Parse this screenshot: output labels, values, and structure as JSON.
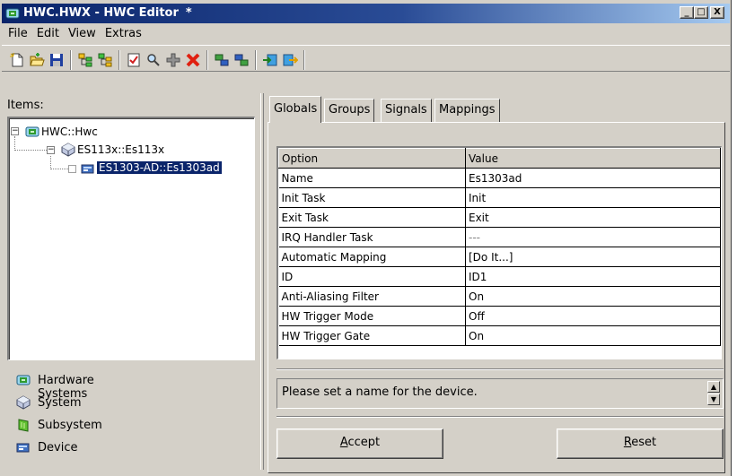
{
  "window": {
    "title": "HWC.HWX - HWC Editor",
    "modified_marker": "*",
    "controls": {
      "minimize": "_",
      "maximize": "□",
      "close": "X"
    }
  },
  "menu": [
    {
      "label": "File"
    },
    {
      "label": "Edit"
    },
    {
      "label": "View"
    },
    {
      "label": "Extras"
    }
  ],
  "toolbar": {
    "icons": [
      "new-file-icon",
      "open-folder-icon",
      "save-disk-icon",
      "tree-structure-icon",
      "tree-structure-alt-icon",
      "checklist-icon",
      "find-icon",
      "add-plus-icon",
      "delete-x-icon",
      "connect-icon",
      "connect-alt-icon",
      "import-icon",
      "export-icon"
    ]
  },
  "left_panel": {
    "items_label": "Items:",
    "tree": [
      {
        "label": "HWC::Hwc",
        "expander": "−",
        "icon": "hardware-system-icon"
      },
      {
        "label": "ES113x::Es113x",
        "expander": "−",
        "icon": "system-icon"
      },
      {
        "label": "ES1303-AD::Es1303ad",
        "expander": "",
        "icon": "device-icon",
        "selected": true
      }
    ],
    "legend": [
      {
        "label": "Hardware Systems",
        "icon": "hardware-system-icon"
      },
      {
        "label": "System",
        "icon": "system-icon"
      },
      {
        "label": "Subsystem",
        "icon": "subsystem-icon"
      },
      {
        "label": "Device",
        "icon": "device-icon"
      }
    ]
  },
  "tabs": [
    {
      "label": "Globals",
      "active": true
    },
    {
      "label": "Groups"
    },
    {
      "label": "Signals"
    },
    {
      "label": "Mappings"
    }
  ],
  "grid": {
    "headers": {
      "option": "Option",
      "value": "Value"
    },
    "rows": [
      {
        "option": "Name",
        "value": "Es1303ad"
      },
      {
        "option": "Init Task",
        "value": "Init"
      },
      {
        "option": "Exit Task",
        "value": "Exit"
      },
      {
        "option": "IRQ Handler Task",
        "value": "---"
      },
      {
        "option": "Automatic Mapping",
        "value": "[Do It...]"
      },
      {
        "option": "ID",
        "value": "ID1"
      },
      {
        "option": "Anti-Aliasing Filter",
        "value": "On"
      },
      {
        "option": "HW Trigger Mode",
        "value": "Off"
      },
      {
        "option": "HW Trigger Gate",
        "value": "On"
      }
    ]
  },
  "description": "Please set a name for the device.",
  "buttons": {
    "accept_key": "A",
    "accept_rest": "ccept",
    "reset_key": "R",
    "reset_rest": "eset"
  },
  "colors": {
    "title_gradient_start": "#0a246a",
    "title_gradient_end": "#a6caf0",
    "selection": "#0a246a",
    "face": "#d4d0c8"
  }
}
